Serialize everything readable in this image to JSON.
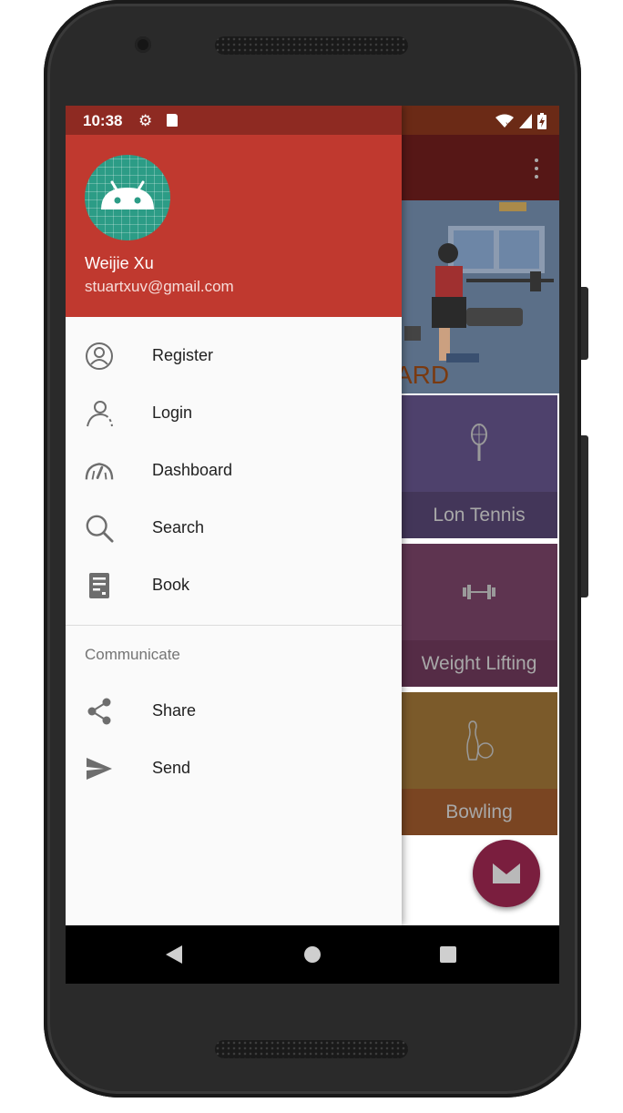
{
  "status_bar": {
    "time": "10:38"
  },
  "drawer": {
    "header": {
      "name": "Weijie Xu",
      "email": "stuartxuv@gmail.com"
    },
    "items": [
      {
        "label": "Register",
        "icon": "account-circle-icon"
      },
      {
        "label": "Login",
        "icon": "person-icon"
      },
      {
        "label": "Dashboard",
        "icon": "speedometer-icon"
      },
      {
        "label": "Search",
        "icon": "search-icon"
      },
      {
        "label": "Book",
        "icon": "book-icon"
      }
    ],
    "section_title": "Communicate",
    "section_items": [
      {
        "label": "Share",
        "icon": "share-icon"
      },
      {
        "label": "Send",
        "icon": "send-icon"
      }
    ]
  },
  "background_app": {
    "hero_text": "ARD",
    "cards": [
      {
        "label": "Lon Tennis",
        "icon": "tennis-racket-icon",
        "color": "#4e416c"
      },
      {
        "label": "Weight Lifting",
        "icon": "dumbbell-icon",
        "color": "#5e3450"
      },
      {
        "label": "Bowling",
        "icon": "bowling-icon",
        "color": "#7b5a2a"
      }
    ]
  },
  "colors": {
    "header": "#c0392f",
    "status": "#8e2a22",
    "drawer_bg": "#fafafa"
  }
}
